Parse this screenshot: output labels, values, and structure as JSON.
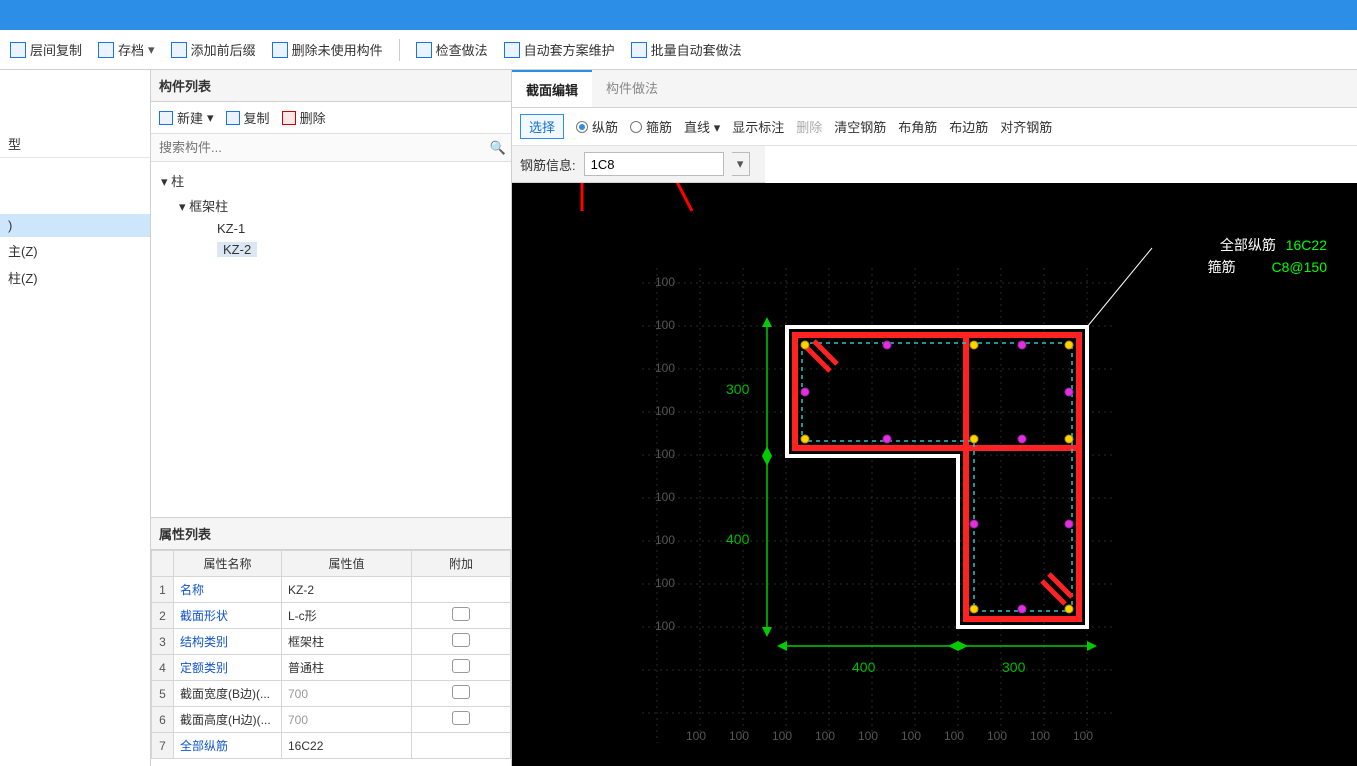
{
  "toolbar": {
    "items": [
      {
        "label": "层间复制"
      },
      {
        "label": "存档"
      },
      {
        "label": "添加前后缀"
      },
      {
        "label": "删除未使用构件"
      },
      {
        "label": "检查做法"
      },
      {
        "label": "自动套方案维护"
      },
      {
        "label": "批量自动套做法"
      }
    ]
  },
  "left": {
    "type_label": "型",
    "row1": ")",
    "row2": "主(Z)",
    "row3": "柱(Z)"
  },
  "componentList": {
    "title": "构件列表",
    "btn_new": "新建",
    "btn_copy": "复制",
    "btn_delete": "删除",
    "search_placeholder": "搜索构件...",
    "tree_root": "柱",
    "tree_sub": "框架柱",
    "items": [
      "KZ-1",
      "KZ-2"
    ]
  },
  "propList": {
    "title": "属性列表",
    "headers": [
      "",
      "属性名称",
      "属性值",
      "附加"
    ],
    "rows": [
      {
        "idx": "1",
        "name": "名称",
        "val": "KZ-2",
        "chk": false,
        "nclass": "",
        "vclass": ""
      },
      {
        "idx": "2",
        "name": "截面形状",
        "val": "L-c形",
        "chk": true,
        "nclass": "",
        "vclass": ""
      },
      {
        "idx": "3",
        "name": "结构类别",
        "val": "框架柱",
        "chk": true,
        "nclass": "",
        "vclass": ""
      },
      {
        "idx": "4",
        "name": "定额类别",
        "val": "普通柱",
        "chk": true,
        "nclass": "",
        "vclass": ""
      },
      {
        "idx": "5",
        "name": "截面宽度(B边)(...",
        "val": "700",
        "chk": true,
        "nclass": "dk",
        "vclass": "grey"
      },
      {
        "idx": "6",
        "name": "截面高度(H边)(...",
        "val": "700",
        "chk": true,
        "nclass": "dk",
        "vclass": "grey"
      },
      {
        "idx": "7",
        "name": "全部纵筋",
        "val": "16C22",
        "chk": false,
        "nclass": "",
        "vclass": ""
      }
    ]
  },
  "rightTabs": {
    "tab1": "截面编辑",
    "tab2": "构件做法"
  },
  "rightTools": {
    "select": "选择",
    "radio1": "纵筋",
    "radio2": "箍筋",
    "straight": "直线",
    "show": "显示标注",
    "delete": "删除",
    "clear": "清空钢筋",
    "corner": "布角筋",
    "edge": "布边筋",
    "align": "对齐钢筋"
  },
  "rebarInfo": {
    "label": "钢筋信息:",
    "value": "1C8"
  },
  "canvas": {
    "all_label": "全部纵筋",
    "all_val": "16C22",
    "stirrup_label": "箍筋",
    "stirrup_val": "C8@150",
    "tick": "100",
    "dim_v1": "300",
    "dim_v2": "400",
    "dim_h1": "400",
    "dim_h2": "300"
  }
}
